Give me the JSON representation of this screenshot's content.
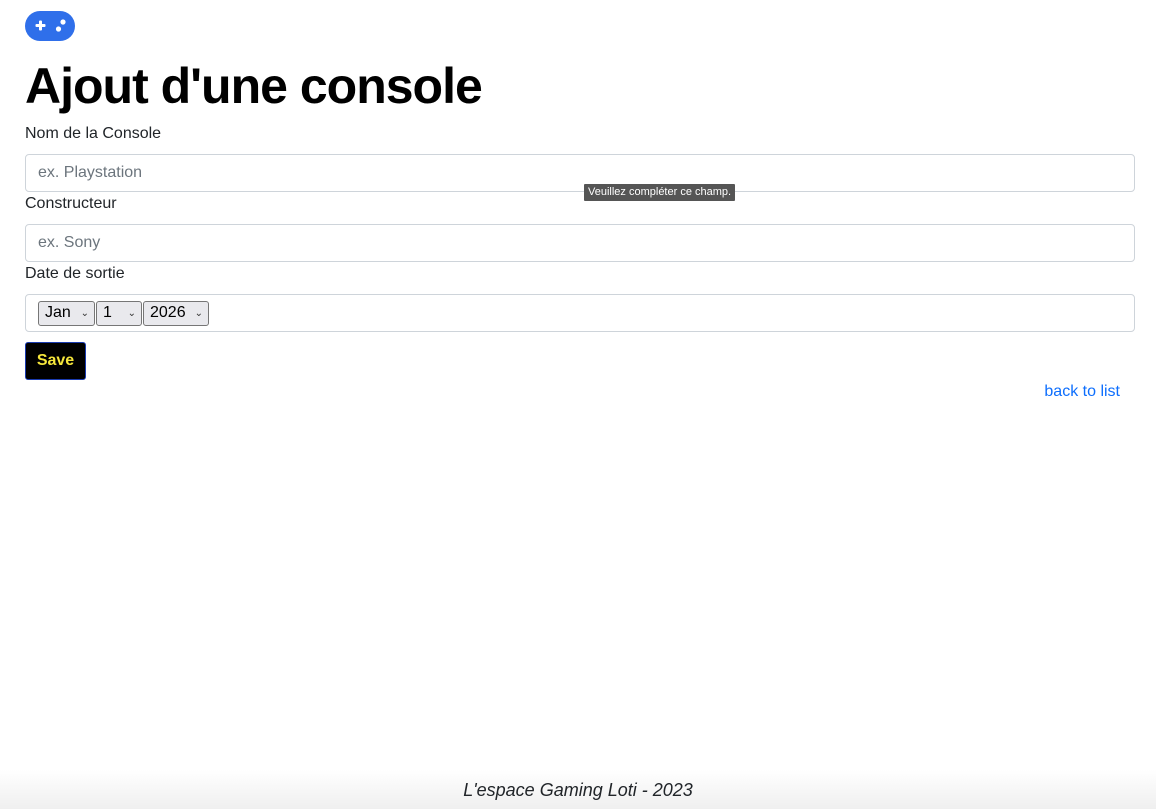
{
  "header": {
    "logo_icon": "gamepad-icon",
    "logo_color": "#2f6fea"
  },
  "page": {
    "title": "Ajout d'une console"
  },
  "form": {
    "name_label": "Nom de la Console",
    "name_placeholder": "ex. Playstation",
    "name_value": "",
    "maker_label": "Constructeur",
    "maker_placeholder": "ex. Sony",
    "maker_value": "",
    "date_label": "Date de sortie",
    "date_month": "Jan",
    "date_day": "1",
    "date_year": "2026",
    "validation_tooltip": "Veuillez compléter ce champ.",
    "save_label": "Save",
    "save_text_color": "#f5e63b",
    "back_label": "back to list"
  },
  "footer": {
    "text": "L'espace Gaming Loti - 2023"
  }
}
